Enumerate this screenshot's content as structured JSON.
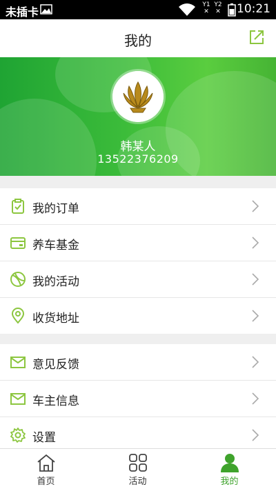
{
  "status_bar": {
    "carrier": "未插卡",
    "sim1": "Y1",
    "sim2": "Y2",
    "time": "10:21"
  },
  "header": {
    "title": "我的"
  },
  "profile": {
    "name": "韩某人",
    "phone": "13522376209"
  },
  "menu_group_1": [
    {
      "label": "我的订单",
      "icon": "clipboard-check-icon"
    },
    {
      "label": "养车基金",
      "icon": "vip-card-icon"
    },
    {
      "label": "我的活动",
      "icon": "ball-icon"
    },
    {
      "label": "收货地址",
      "icon": "location-pin-icon"
    }
  ],
  "menu_group_2": [
    {
      "label": "意见反馈",
      "icon": "mail-icon"
    },
    {
      "label": "车主信息",
      "icon": "mail-icon"
    },
    {
      "label": "设置",
      "icon": "gear-icon"
    }
  ],
  "bottom_nav": [
    {
      "label": "首页",
      "icon": "home-icon"
    },
    {
      "label": "活动",
      "icon": "grid-icon"
    },
    {
      "label": "我的",
      "icon": "user-icon",
      "active": true
    }
  ],
  "colors": {
    "accent": "#3fa32c",
    "icon_green": "#8cc63f",
    "header_green": "#3cbc3a"
  }
}
